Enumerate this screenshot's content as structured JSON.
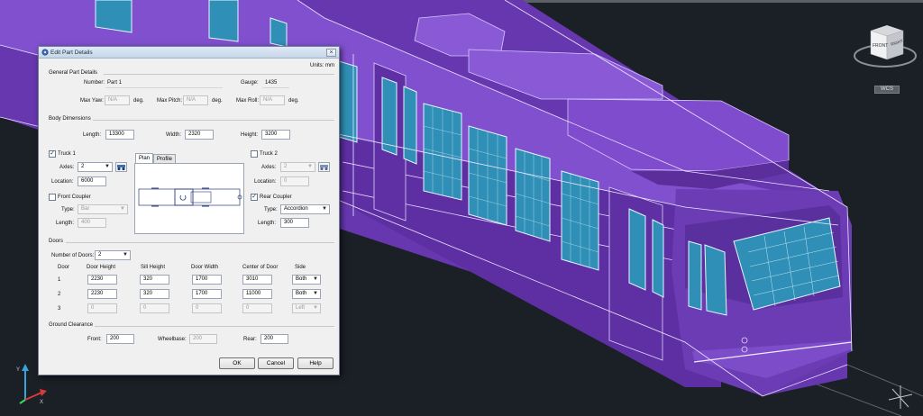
{
  "dialog": {
    "title": "Edit Part Details",
    "close_glyph": "×",
    "units": "Units: mm",
    "general": {
      "heading": "General Part Details",
      "number_label": "Number:",
      "number_value": "Part 1",
      "gauge_label": "Gauge:",
      "gauge_value": "1435",
      "max_yaw_label": "Max Yaw:",
      "max_yaw_value": "N/A",
      "max_pitch_label": "Max Pitch:",
      "max_pitch_value": "N/A",
      "max_roll_label": "Max Roll:",
      "max_roll_value": "N/A",
      "deg": "deg."
    },
    "body": {
      "heading": "Body Dimensions",
      "length_label": "Length:",
      "length_value": "13300",
      "width_label": "Width:",
      "width_value": "2320",
      "height_label": "Height:",
      "height_value": "3200"
    },
    "truck1": {
      "label": "Truck 1",
      "checked": "✓",
      "axles_label": "Axles:",
      "axles_value": "2",
      "location_label": "Location:",
      "location_value": "6000"
    },
    "truck2": {
      "label": "Truck 2",
      "checked": "",
      "axles_label": "Axles:",
      "axles_value": "2",
      "location_label": "Location:",
      "location_value": "0"
    },
    "tabs": [
      "Plan",
      "Profile"
    ],
    "front_coupler": {
      "label": "Front Coupler",
      "checked": "",
      "type_label": "Type:",
      "type_value": "Bar",
      "length_label": "Length:",
      "length_value": "400"
    },
    "rear_coupler": {
      "label": "Rear Coupler",
      "checked": "✓",
      "type_label": "Type:",
      "type_value": "Accordion",
      "length_label": "Length:",
      "length_value": "300"
    },
    "doors": {
      "heading": "Doors",
      "count_label": "Number of Doors:",
      "count_value": "2",
      "headers": [
        "Door",
        "Door Height",
        "Sill Height",
        "Door Width",
        "Center of Door",
        "Side"
      ],
      "rows": [
        {
          "door": "1",
          "height": "2230",
          "sill": "320",
          "width": "1700",
          "center": "3010",
          "side": "Both"
        },
        {
          "door": "2",
          "height": "2230",
          "sill": "320",
          "width": "1700",
          "center": "11000",
          "side": "Both"
        },
        {
          "door": "3",
          "height": "0",
          "sill": "0",
          "width": "0",
          "center": "0",
          "side": "Left"
        }
      ]
    },
    "ground": {
      "heading": "Ground Clearance",
      "front_label": "Front:",
      "front_value": "200",
      "wheelbase_label": "Wheelbase:",
      "wheelbase_value": "200",
      "rear_label": "Rear:",
      "rear_value": "200"
    },
    "buttons": {
      "ok": "OK",
      "cancel": "Cancel",
      "help": "Help"
    }
  },
  "viewcube": {
    "front": "FRONT",
    "right": "RIGHT",
    "wcs": "WCS"
  },
  "ucs": {
    "x": "X",
    "y": "Y"
  },
  "colors": {
    "background": "#1b1f26",
    "body_purple": "#6b3fb0",
    "window_blue": "#2f8fb6",
    "dialog_bg": "#f0f0f0",
    "titlebar": "#c6d6ea"
  },
  "icons": [
    "truck-axle-icon",
    "close-icon",
    "dropdown-arrow-icon",
    "viewcube-icon",
    "ucs-icon"
  ]
}
